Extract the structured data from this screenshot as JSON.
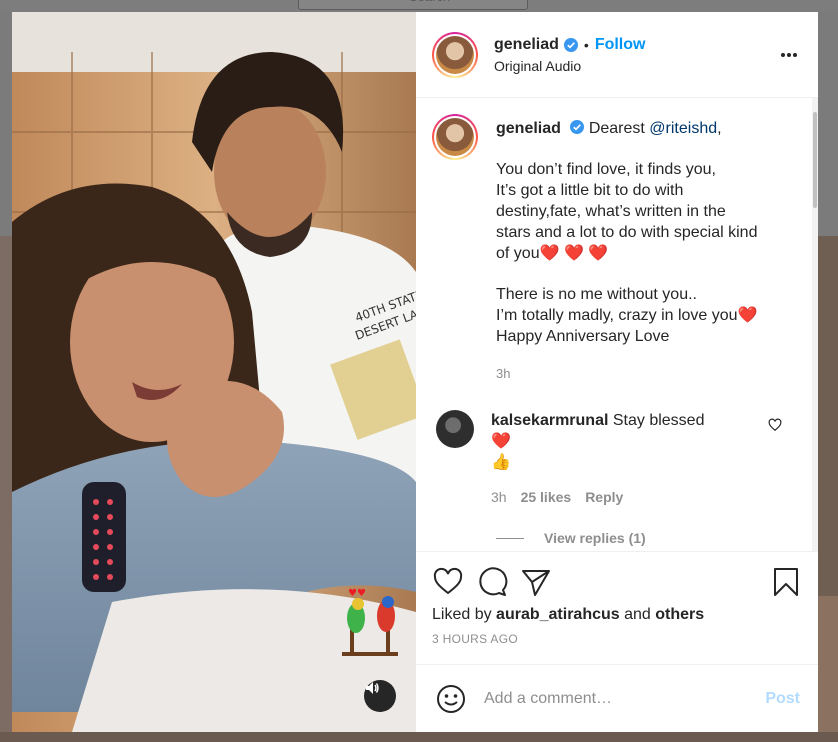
{
  "background": {
    "search_placeholder": "Search"
  },
  "post": {
    "username": "geneliad",
    "follow_label": "Follow",
    "dot": "•",
    "audio": "Original Audio",
    "caption": {
      "username": "geneliad",
      "intro": "Dearest",
      "mention": "@riteishd",
      "comma": ",",
      "p1_lines": [
        "You don’t find love, it finds you,",
        "It’s got a little bit to do with",
        "destiny,fate, what’s written in the",
        "stars and a lot to do with special kind",
        "of you"
      ],
      "p1_hearts": "❤️ ❤️ ❤️",
      "p2_lines": [
        "There is no me without you..",
        "I’m totally madly, crazy in love you"
      ],
      "p2_heart": "❤️",
      "p2_last": "Happy Anniversary Love",
      "time": "3h"
    },
    "comment": {
      "username": "kalsekarmrunal",
      "text": "Stay blessed",
      "heart": "❤️",
      "thumb": "👍",
      "time": "3h",
      "likes": "25 likes",
      "reply_label": "Reply",
      "view_replies": "View replies (1)"
    },
    "likes": {
      "prefix": "Liked by",
      "user": "aurab_atirahcus",
      "and": "and",
      "others": "others"
    },
    "posted_ago": "3 HOURS AGO",
    "composer": {
      "placeholder": "Add a comment…",
      "post_label": "Post"
    },
    "colors": {
      "link": "#0095f6",
      "post_disabled": "#b3dbff",
      "heart": "#ed1c24"
    },
    "icons": [
      "heart-icon",
      "comment-icon",
      "share-icon",
      "bookmark-icon",
      "emoji-icon",
      "sound-icon",
      "more-icon",
      "verified-icon"
    ]
  }
}
